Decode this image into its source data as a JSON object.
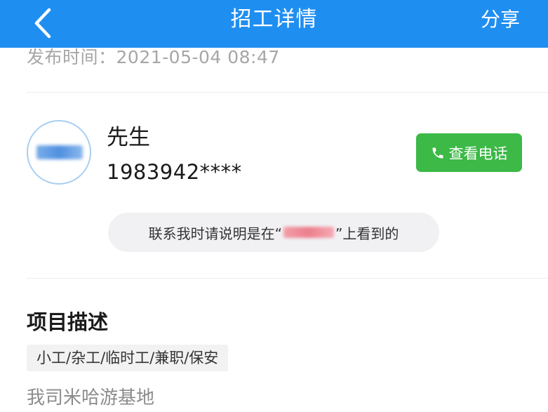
{
  "header": {
    "title": "招工详情",
    "share_label": "分享",
    "background_color": "#1f8ef1"
  },
  "publish": {
    "label": "发布时间：",
    "value": "2021-05-04 08:47"
  },
  "contact": {
    "name": "先生",
    "phone": "1983942****",
    "call_button_label": "查看电话",
    "call_button_color": "#3cb947"
  },
  "notice": {
    "prefix": "联系我时请说明是在“",
    "suffix": "”上看到的"
  },
  "project": {
    "section_title": "项目描述",
    "tag": "小工/杂工/临时工/兼职/保安",
    "description": "我司米哈游基地"
  },
  "icons": {
    "back": "chevron-left-icon",
    "phone": "phone-icon"
  }
}
